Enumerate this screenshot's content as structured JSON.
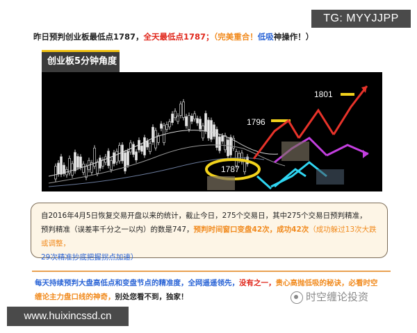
{
  "watermark_tag": "TG: MYYJJPP",
  "headline": {
    "part1": "昨日预判创业板最低点1787，",
    "part2": "全天最低点1787；",
    "part3": "（完美重合！",
    "part4": "低吸",
    "part5": "神操作！）"
  },
  "chart": {
    "tab_label": "创业板5分钟角度",
    "label_1801": "1801",
    "label_1796": "1796",
    "label_1787": "1787",
    "colors": {
      "background": "#000000",
      "candles": "#d8d8d8",
      "arrow_red": "#e8332a",
      "arrow_magenta": "#c43fe0",
      "arrow_cyan": "#2fd6f2",
      "marker_yellow": "#f2d21c"
    }
  },
  "card": {
    "text1": "自2016年4月5日恢复交易开盘以来的统计，截止今日，275个交易日，其中275个交易日预判精准，",
    "text2": "预判精准（误差率千分之一以内）的数是747，",
    "text3": "预判时间窗口变盘42次，成功42次",
    "text4": "（成功躲过13次大跌或调整，",
    "text5": "29次精准抄底把握拐点加速）"
  },
  "bottom": {
    "text1": "每天持续预判大盘高低点和变盘节点的精准度，",
    "text2": "全网遥遥领先，",
    "text3": "没有之一，",
    "text4": "贵心高抛低吸的秘诀，必看时空缠论主力盘口线的神奇，",
    "text5": "别处您看不到，独家！"
  },
  "logo_text": "时空缠论投资",
  "site_tag": "www.huixincssd.cn"
}
